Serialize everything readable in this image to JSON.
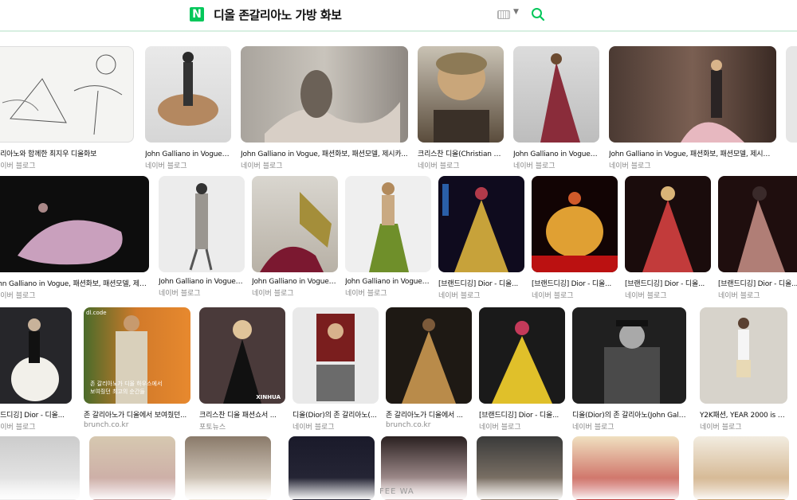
{
  "search": {
    "query": "디올 존갈리아노 가방 화보",
    "logo": "N"
  },
  "colors": {
    "brand": "#03c75a"
  },
  "rows": [
    [
      {
        "caption": "갈리아노와 함께한 최지우 디올화보",
        "source": "네이버 블로그"
      },
      {
        "caption": "John Galliano in Vogue, 패...",
        "source": "네이버 블로그"
      },
      {
        "caption": "John Galliano in Vogue, 패션화보, 패션모델, 제시카...",
        "source": "네이버 블로그"
      },
      {
        "caption": "크리스찬 디올(Christian Di...",
        "source": "네이버 블로그"
      },
      {
        "caption": "John Galliano in Vogue, 패...",
        "source": "네이버 블로그"
      },
      {
        "caption": "John Galliano in Vogue, 패션화보, 패션모델, 제시카스...",
        "source": "네이버 블로그"
      }
    ],
    [
      {
        "caption": "ohn Galliano in Vogue, 패션화보, 패션모델, 제시카...",
        "source": "네이버 블로그"
      },
      {
        "caption": "John Galliano in Vogue, ...",
        "source": "네이버 블로그"
      },
      {
        "caption": "John Galliano in Vogue, ...",
        "source": "네이버 블로그"
      },
      {
        "caption": "John Galliano in Vogue, ...",
        "source": "네이버 블로그"
      },
      {
        "caption": "[브랜드디깅] Dior - 디올...",
        "source": "네이버 블로그"
      },
      {
        "caption": "[브랜드디깅] Dior - 디올...",
        "source": "네이버 블로그"
      },
      {
        "caption": "[브랜드디깅] Dior - 디올...",
        "source": "네이버 블로그"
      },
      {
        "caption": "[브랜드디깅] Dior - 디올...",
        "source": "네이버 블로그"
      }
    ],
    [
      {
        "caption": "랜드디깅] Dior - 디올...",
        "source": "네이버 블로그"
      },
      {
        "caption": "존 갈리아노가 디올에서 보여줬던...",
        "source": "brunch.co.kr",
        "overlay": "존 갈리아노가 디올 하우스에서\n보여줬던 최고의 순간들"
      },
      {
        "caption": "크리스찬 디올 패션쇼서 ...",
        "source": "포토뉴스"
      },
      {
        "caption": "디올(Dior)의 존 갈리아노(...",
        "source": "네이버 블로그"
      },
      {
        "caption": "존 갈리아노가 디올에서 ...",
        "source": "brunch.co.kr"
      },
      {
        "caption": "[브랜드디깅] Dior - 디올...",
        "source": "네이버 블로그"
      },
      {
        "caption": "디올(Dior)의 존 갈리아노(John Gallia...",
        "source": "네이버 블로그"
      },
      {
        "caption": "Y2K패션, YEAR 2000 is ba...",
        "source": "네이버 블로그"
      }
    ]
  ],
  "thumb_labels": {
    "dlcode": "dl.code",
    "xinhua": "XINHUA"
  },
  "footer_watermark": "FEE WA"
}
